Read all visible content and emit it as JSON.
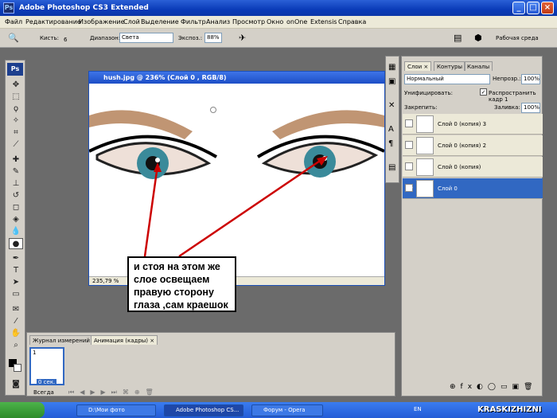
{
  "window": {
    "app_icon": "Ps",
    "title": "Adobe Photoshop CS3 Extended"
  },
  "menu": [
    "Файл",
    "Редактирование",
    "Изображение",
    "Слой",
    "Выделение",
    "Фильтр",
    "Анализ",
    "Просмотр",
    "Окно",
    "onOne",
    "Extensis",
    "Справка"
  ],
  "options": {
    "brush_label": "Кисть:",
    "brush_size": "6",
    "range_label": "Диапазон:",
    "range_value": "Света",
    "exposure_label": "Экспоз.:",
    "exposure_value": "88%",
    "workspace": "Рабочая среда"
  },
  "document": {
    "title": "hush.jpg @ 236% (Слой 0 , RGB/8)",
    "zoom": "235,79 %"
  },
  "annotation": {
    "text": "и стоя на этом же слое освещаем правую сторону глаза ,сам краешок",
    "color": "#cc0000"
  },
  "layers_panel": {
    "tabs": [
      "Слои",
      "Контуры",
      "Каналы"
    ],
    "blend_mode": "Нормальный",
    "opacity_label": "Непрозр.:",
    "opacity_value": "100%",
    "unify_label": "Унифицировать:",
    "propagate_label": "Распространить кадр 1",
    "lock_label": "Закрепить:",
    "fill_label": "Заливка:",
    "fill_value": "100%",
    "layers": [
      {
        "name": "Слой 0 (копия) 3",
        "selected": false
      },
      {
        "name": "Слой 0 (копия) 2",
        "selected": false
      },
      {
        "name": "Слой 0 (копия)",
        "selected": false
      },
      {
        "name": "Слой 0",
        "selected": true
      }
    ]
  },
  "animation_panel": {
    "tabs": [
      "Журнал измерений",
      "Анимация (кадры)"
    ],
    "frame_number": "1",
    "frame_time": "0 сек.",
    "loop": "Всегда"
  },
  "taskbar": {
    "items": [
      "D:\\Мои фото",
      "Adobe Photoshop CS...",
      "Форум - Opera"
    ],
    "lang": "EN",
    "watermark": "KRASKIZHIZNI"
  }
}
